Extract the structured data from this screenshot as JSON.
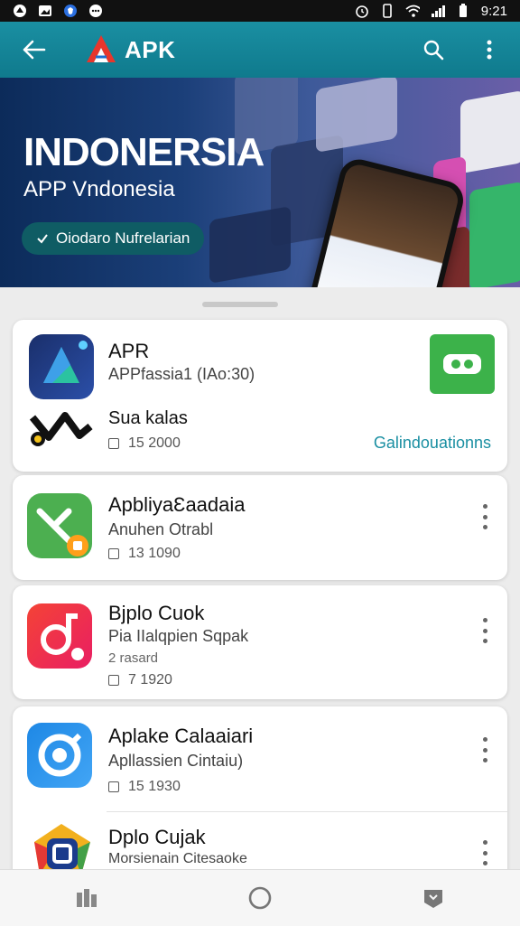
{
  "status": {
    "time": "9:21"
  },
  "appbar": {
    "title": "APK",
    "colors": {
      "bar": "#1a8fa2"
    }
  },
  "hero": {
    "title": "INDONERSIA",
    "subtitle": "APP Vndonesia",
    "chip_label": "Oiodaro Nufrelarian"
  },
  "cards": [
    {
      "name": "APR",
      "subtitle": "APPfassia1 (IAo:30)",
      "extra_title": "Sua kalas",
      "meta": "15  2000",
      "action_link": "Galindouationns"
    },
    {
      "name": "ApbliyaƐaadaia",
      "subtitle": "Anuhen Otrabl",
      "meta": "13  1090"
    },
    {
      "name": "Bjplo Cuok",
      "subtitle": "Pia IIalqpien Sqpak",
      "detail": "2 rasard",
      "meta": "7  1920"
    },
    {
      "name": "Aplake Calaaiari",
      "subtitle": "Apllassien Cintaiu)",
      "meta": "15  1930"
    },
    {
      "name": "Dplo Cujak",
      "subtitle": "Morsienain Citesaoke"
    }
  ],
  "icons": {
    "back": "arrow-left-icon",
    "search": "search-icon",
    "more": "more-vert-icon",
    "nav": [
      "recents-icon",
      "home-icon",
      "back-nav-icon"
    ]
  }
}
